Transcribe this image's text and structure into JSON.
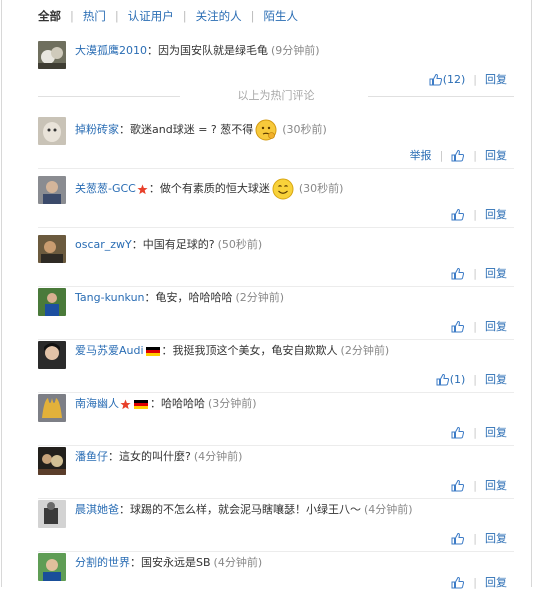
{
  "filters": [
    {
      "label": "全部",
      "active": true
    },
    {
      "label": "热门",
      "active": false
    },
    {
      "label": "认证用户",
      "active": false
    },
    {
      "label": "关注的人",
      "active": false
    },
    {
      "label": "陌生人",
      "active": false
    }
  ],
  "hot_divider_text": "以上为热门评论",
  "actions": {
    "report": "举报",
    "reply": "回复"
  },
  "colors": {
    "link": "#2a6db4",
    "text": "#333333",
    "muted": "#888888",
    "separator": "#ececec"
  },
  "comments": [
    {
      "username": "大漠孤鹰2010",
      "content": "因为国安队就是绿毛龟",
      "time": "(9分钟前)",
      "like_count": "(12)",
      "report": false,
      "badge": null,
      "emoji": null
    },
    {
      "username": "掉粉砖家",
      "content": "歌迷and球迷 = ? 葱不得",
      "time": "(30秒前)",
      "like_count": "",
      "report": true,
      "badge": null,
      "emoji": "thinking-face"
    },
    {
      "username": "关葱葱-GCC",
      "content": "做个有素质的恒大球迷",
      "time": "(30秒前)",
      "like_count": "",
      "report": false,
      "badge": "star-icon",
      "emoji": "smiley-face"
    },
    {
      "username": "oscar_zwY",
      "content": "中国有足球的?",
      "time": "(50秒前)",
      "like_count": "",
      "report": false,
      "badge": null,
      "emoji": null
    },
    {
      "username": "Tang-kunkun",
      "content": "龟安，哈哈哈哈",
      "time": "(2分钟前)",
      "like_count": "",
      "report": false,
      "badge": null,
      "emoji": null
    },
    {
      "username": "爱马苏爱Audi",
      "content": "我挺我顶这个美女，龟安自欺欺人",
      "time": "(2分钟前)",
      "like_count": "(1)",
      "report": false,
      "badge": "german-flag-icon",
      "emoji": null
    },
    {
      "username": "南海幽人",
      "content": "哈哈哈哈",
      "time": "(3分钟前)",
      "like_count": "",
      "report": false,
      "badge": "star-and-german-flag-icon",
      "emoji": null
    },
    {
      "username": "潘鱼仔",
      "content": "這女的叫什麼?",
      "time": "(4分钟前)",
      "like_count": "",
      "report": false,
      "badge": null,
      "emoji": null
    },
    {
      "username": "晨淇她爸",
      "content": "球踢的不怎么样，就会泥马瞎嚷瑟！小绿王八～",
      "time": "(4分钟前)",
      "like_count": "",
      "report": false,
      "badge": null,
      "emoji": null
    },
    {
      "username": "分割的世界",
      "content": "国安永远是SB",
      "time": "(4分钟前)",
      "like_count": "",
      "report": false,
      "badge": null,
      "emoji": null
    }
  ]
}
